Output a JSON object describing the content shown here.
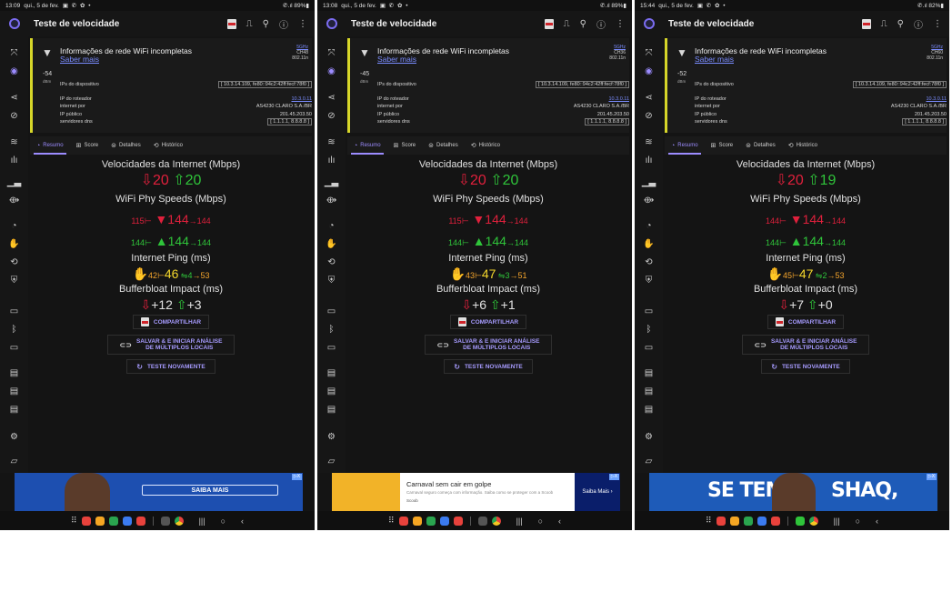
{
  "phones": [
    {
      "status": {
        "time": "13:09",
        "date": "qui., 5 de fev.",
        "icons": "▣ ✆ ✿ •",
        "right": "✆.ıl 89%▮"
      },
      "title": "Teste de velocidade",
      "info": {
        "title": "Informações de rede WiFi incompletas",
        "link": "Saber mais",
        "rssi": "-54",
        "dbm": "dBm",
        "band": "5GHz",
        "channel": "CH48",
        "std": "802.11n"
      },
      "rows": [
        {
          "k": "IPs do dispositivo",
          "v": "[ 10.3.14.109, fe80::94c2:42ff:fecf:78f0 ]",
          "style": "boxed"
        },
        {
          "k": "IP do roteador",
          "v": "10.3.0.11",
          "style": "link"
        },
        {
          "k": "internet por",
          "v": "AS4230 CLARO S.A./BR",
          "style": ""
        },
        {
          "k": "IP público",
          "v": "201.45.203.50",
          "style": ""
        },
        {
          "k": "servidores dns",
          "v": "[ 1.1.1.1, 8.8.8.8 ]",
          "style": "boxed"
        }
      ],
      "results": {
        "down": "20",
        "up": "20",
        "phy_down_min": "115",
        "phy_down": "144",
        "phy_down_max": "144",
        "phy_up_min": "144",
        "phy_up": "144",
        "phy_up_max": "144",
        "ping_min": "42",
        "ping": "46",
        "ping_jitter": "4",
        "ping_max": "53",
        "bb_down": "+12",
        "bb_up": "+3"
      },
      "ad": {
        "type": "shaq",
        "label": "SAIBA MAIS"
      }
    },
    {
      "status": {
        "time": "13:08",
        "date": "qui., 5 de fev.",
        "icons": "▣ ✆ ✿ •",
        "right": "✆.ıl 89%▮"
      },
      "title": "Teste de velocidade",
      "info": {
        "title": "Informações de rede WiFi incompletas",
        "link": "Saber mais",
        "rssi": "-45",
        "dbm": "dBm",
        "band": "5GHz",
        "channel": "CH36",
        "std": "802.11n"
      },
      "rows": [
        {
          "k": "IPs do dispositivo",
          "v": "[ 10.3.14.109, fe80::94c2:42ff:fecf:78f0 ]",
          "style": "boxed"
        },
        {
          "k": "IP do roteador",
          "v": "10.3.0.11",
          "style": "link"
        },
        {
          "k": "internet por",
          "v": "AS4230 CLARO S.A./BR",
          "style": ""
        },
        {
          "k": "IP público",
          "v": "201.45.203.50",
          "style": ""
        },
        {
          "k": "servidores dns",
          "v": "[ 1.1.1.1, 8.8.8.8 ]",
          "style": "boxed"
        }
      ],
      "results": {
        "down": "20",
        "up": "20",
        "phy_down_min": "115",
        "phy_down": "144",
        "phy_down_max": "144",
        "phy_up_min": "144",
        "phy_up": "144",
        "phy_up_max": "144",
        "ping_min": "43",
        "ping": "47",
        "ping_jitter": "3",
        "ping_max": "51",
        "bb_down": "+6",
        "bb_up": "+1"
      },
      "ad": {
        "type": "carnaval",
        "headline": "Carnaval sem cair em golpe",
        "body": "Carnaval seguro começa com informação. Saiba como se proteger com a Scoob",
        "brand": "Scoob",
        "cta": "Saiba Mais"
      }
    },
    {
      "status": {
        "time": "15:44",
        "date": "qui., 5 de fev.",
        "icons": "▣ ✆ ✿ •",
        "right": "✆.ıl 82%▮"
      },
      "title": "Teste de velocidade",
      "info": {
        "title": "Informações de rede WiFi incompletas",
        "link": "Saber mais",
        "rssi": "-52",
        "dbm": "dBm",
        "band": "5GHz",
        "channel": "CH60",
        "std": "802.11n"
      },
      "rows": [
        {
          "k": "IPs do dispositivo",
          "v": "[ 10.3.14.109, fe80::94c2:42ff:fecf:78f0 ]",
          "style": "boxed"
        },
        {
          "k": "IP do roteador",
          "v": "10.3.0.11",
          "style": "link"
        },
        {
          "k": "internet por",
          "v": "AS4230 CLARO S.A./BR",
          "style": ""
        },
        {
          "k": "IP público",
          "v": "201.45.203.50",
          "style": ""
        },
        {
          "k": "servidores dns",
          "v": "[ 1.1.1.1, 8.8.8.8 ]",
          "style": "boxed"
        }
      ],
      "results": {
        "down": "20",
        "up": "19",
        "phy_down_min": "144",
        "phy_down": "144",
        "phy_down_max": "144",
        "phy_up_min": "144",
        "phy_up": "144",
        "phy_up_max": "144",
        "ping_min": "45",
        "ping": "47",
        "ping_jitter": "2",
        "ping_max": "53",
        "bb_down": "+7",
        "bb_up": "+0"
      },
      "ad": {
        "type": "setem",
        "left": "SE TEM",
        "right": "SHAQ,"
      }
    }
  ],
  "labels": {
    "tabs": [
      "Resumo",
      "Score",
      "Detalhes",
      "Histórico"
    ],
    "internet_speeds": "Velocidades da Internet (Mbps)",
    "phy_speeds": "WiFi Phy Speeds (Mbps)",
    "ping": "Internet Ping (ms)",
    "bufferbloat": "Bufferbloat Impact (ms)",
    "share": "COMPARTILHAR",
    "save_line1": "SALVAR & E INICIAR ANÁLISE",
    "save_line2": "DE MÚLTIPLOS LOCAIS",
    "retest": "TESTE NOVAMENTE"
  },
  "colors": {
    "accent": "#9c8cff",
    "download": "#e0203c",
    "upload": "#2fc43a",
    "ping": "#f3a42c",
    "warning_bar": "#d6d629"
  },
  "icons": {
    "top": [
      "pdf-icon",
      "chart-icon",
      "pin-icon",
      "help-icon",
      "more-icon"
    ],
    "sidebar": [
      "no-location-icon",
      "location-icon",
      "share-icon",
      "check-icon",
      "wifi-icon",
      "bars-icon",
      "speed-icon",
      "antenna-icon",
      "gauge-icon",
      "hand-icon",
      "history-icon",
      "shield-icon",
      "device-icon",
      "bluetooth-icon",
      "monitor-icon",
      "server-icon",
      "server-icon",
      "server-icon",
      "settings-icon",
      "message-icon"
    ]
  }
}
